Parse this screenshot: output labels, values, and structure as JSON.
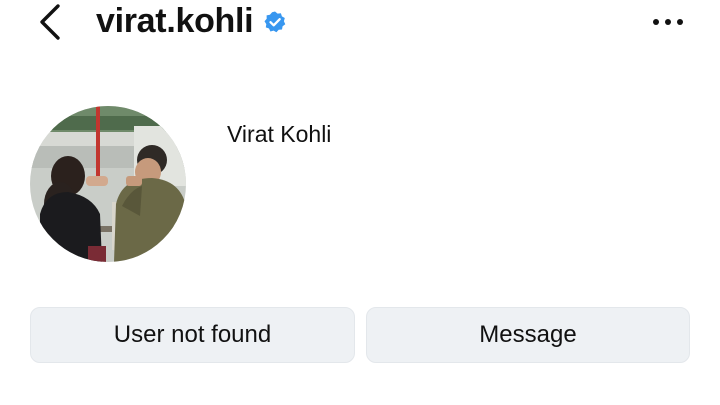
{
  "header": {
    "username": "virat.kohli",
    "back_icon": "chevron-left-icon",
    "verified_icon": "verified-badge-icon",
    "more_icon": "more-horizontal-icon",
    "verified_color": "#3897f0"
  },
  "profile": {
    "display_name": "Virat Kohli",
    "avatar_icon": "profile-photo"
  },
  "actions": {
    "primary_label": "User not found",
    "message_label": "Message"
  },
  "colors": {
    "button_bg": "#eef1f4",
    "text": "#111111",
    "background": "#ffffff"
  }
}
